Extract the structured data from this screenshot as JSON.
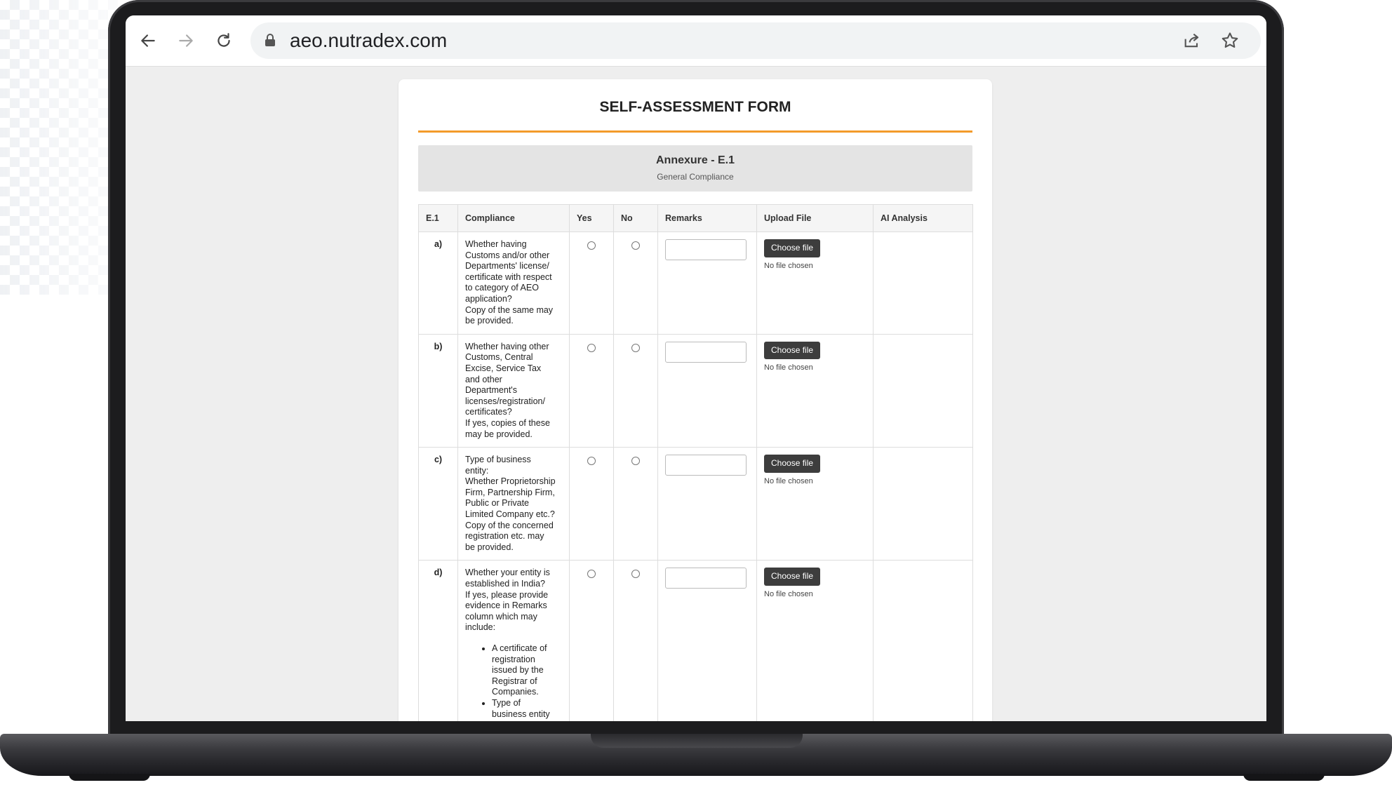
{
  "browser": {
    "url": "aeo.nutradex.com"
  },
  "form": {
    "title": "SELF-ASSESSMENT FORM",
    "annexure_title": "Annexure - E.1",
    "annexure_subtitle": "General Compliance",
    "accent_color": "#f39b2a"
  },
  "table": {
    "headers": {
      "index": "E.1",
      "compliance": "Compliance",
      "yes": "Yes",
      "no": "No",
      "remarks": "Remarks",
      "upload": "Upload File",
      "ai": "AI Analysis"
    },
    "upload_button_label": "Choose file",
    "upload_status": "No file chosen",
    "rows": [
      {
        "index": "a)",
        "lines": [
          "Whether having",
          "Customs and/or other",
          "Departments' license/",
          "certificate with respect",
          "to category of AEO",
          "application?",
          "Copy of the same may",
          "be provided."
        ]
      },
      {
        "index": "b)",
        "lines": [
          "Whether having other",
          "Customs, Central",
          "Excise, Service Tax",
          "and other",
          "Department's",
          "licenses/registration/",
          "certificates?",
          "If yes, copies of these",
          "may be provided."
        ]
      },
      {
        "index": "c)",
        "lines": [
          "Type of business",
          "entity:",
          "Whether Proprietorship",
          "Firm, Partnership Firm,",
          "Public or Private",
          "Limited Company etc.?",
          "Copy of the concerned",
          "registration etc. may",
          "be provided."
        ]
      },
      {
        "index": "d)",
        "lines": [
          "Whether your entity is",
          "established in India?",
          "If yes, please provide",
          "evidence in Remarks",
          "column which may",
          "include:"
        ],
        "bullets": [
          [
            "A certificate of",
            "registration",
            "issued by the",
            "Registrar of",
            "Companies."
          ],
          [
            "Type of",
            "business entity"
          ]
        ]
      }
    ]
  }
}
